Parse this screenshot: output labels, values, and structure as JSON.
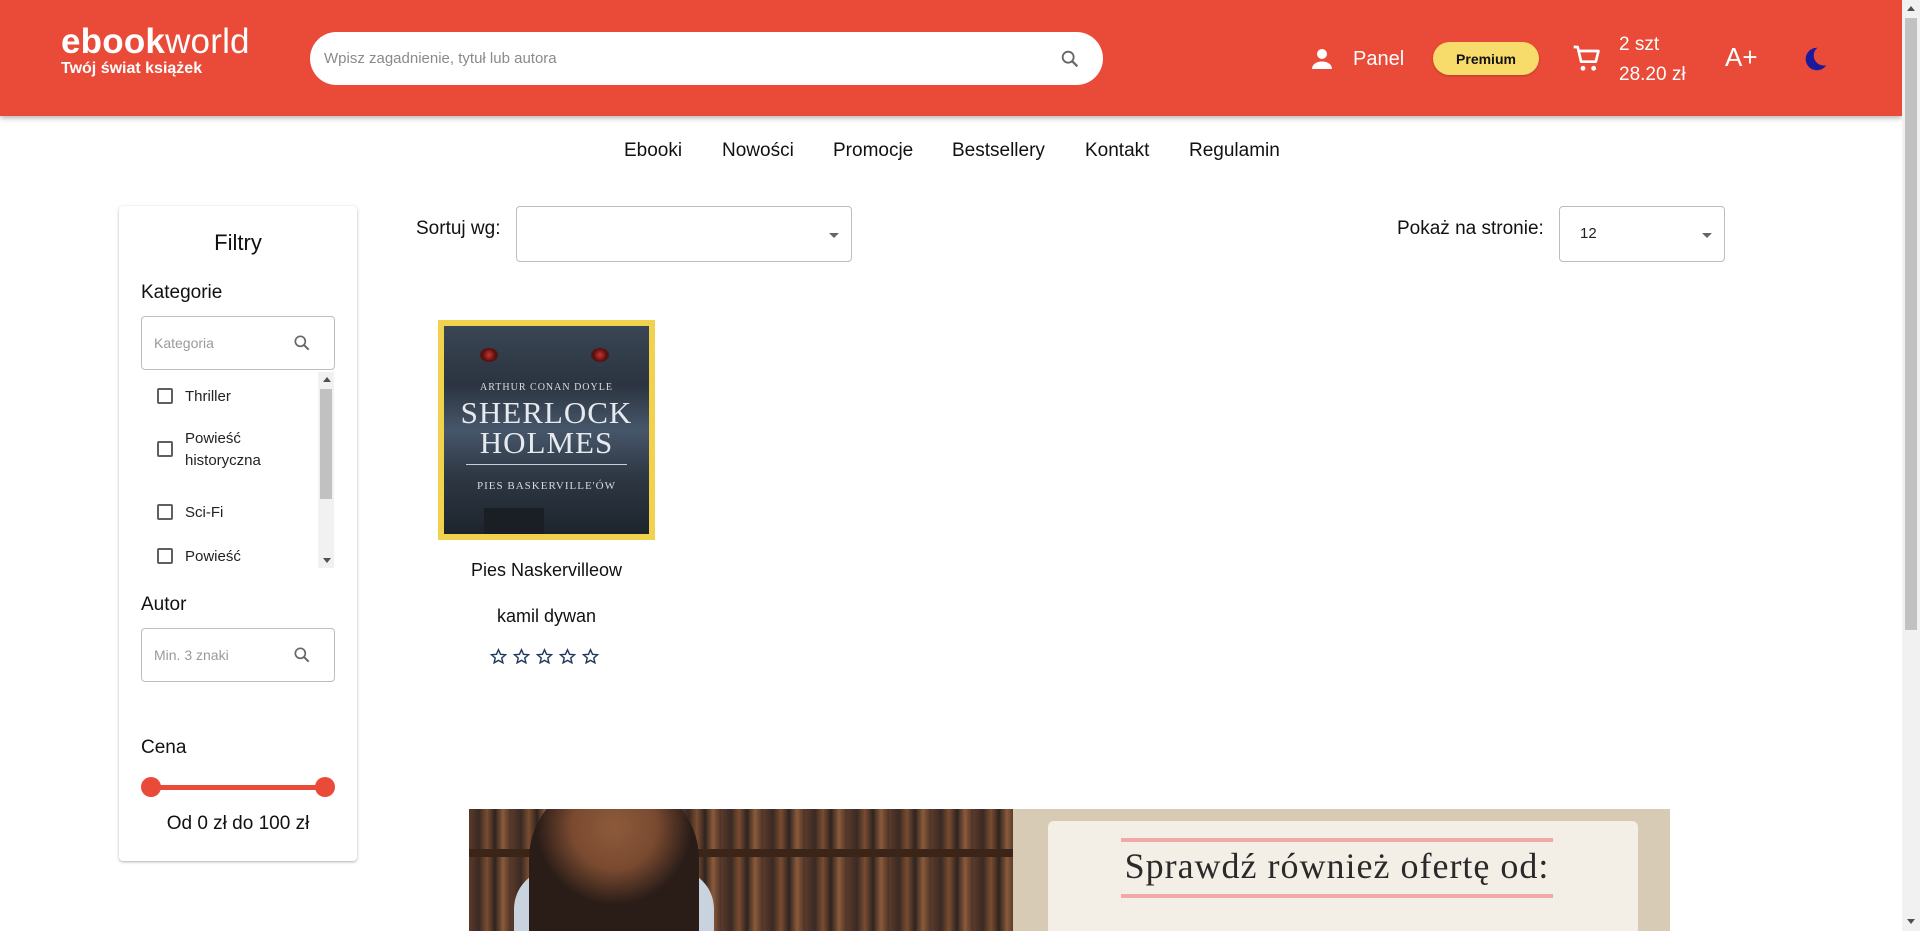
{
  "header": {
    "logo_bold": "ebook",
    "logo_light": "world",
    "tagline": "Twój świat książek",
    "search_placeholder": "Wpisz zagadnienie, tytuł lub autora",
    "panel_label": "Panel",
    "premium_label": "Premium",
    "cart_count": "2 szt",
    "cart_total": "28.20 zł",
    "font_size_label": "A+",
    "accent_color": "#ea4a38"
  },
  "nav": {
    "items": [
      "Ebooki",
      "Nowości",
      "Promocje",
      "Bestsellery",
      "Kontakt",
      "Regulamin"
    ]
  },
  "filters": {
    "title": "Filtry",
    "category_label": "Kategorie",
    "category_placeholder": "Kategoria",
    "categories": [
      "Thriller",
      "Powieść historyczna",
      "Sci-Fi",
      "Powieść"
    ],
    "author_label": "Autor",
    "author_placeholder": "Min. 3 znaki",
    "price_label": "Cena",
    "price_range_text": "Od 0 zł do 100 zł",
    "price_min": 0,
    "price_max": 100
  },
  "toolbar": {
    "sort_label": "Sortuj wg:",
    "sort_value": "",
    "per_page_label": "Pokaż na stronie:",
    "per_page_value": "12"
  },
  "products": [
    {
      "title": "Pies Naskervilleow",
      "author": "kamil dywan",
      "rating": 0,
      "max_rating": 5,
      "cover": {
        "author": "ARTHUR CONAN DOYLE",
        "title_line1": "SHERLOCK",
        "title_line2": "HOLMES",
        "subtitle": "PIES BASKERVILLE'ÓW"
      }
    }
  ],
  "banner": {
    "text": "Sprawdź również ofertę od:"
  }
}
